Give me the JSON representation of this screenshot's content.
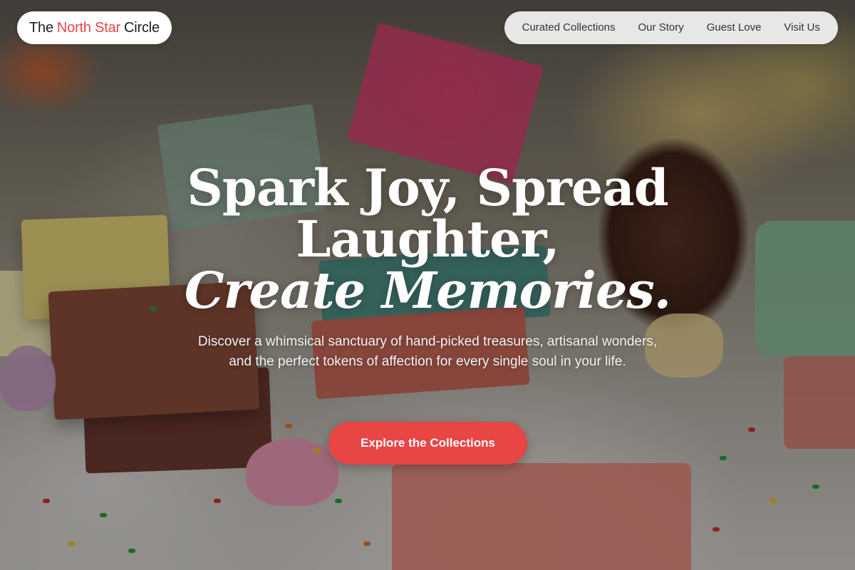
{
  "header": {
    "brand_prefix": "The",
    "brand_accent": "North Star",
    "brand_suffix": "Circle",
    "nav": [
      {
        "label": "Curated Collections"
      },
      {
        "label": "Our Story"
      },
      {
        "label": "Guest Love"
      },
      {
        "label": "Visit Us"
      }
    ]
  },
  "hero": {
    "headline_line1": "Spark Joy, Spread",
    "headline_line2": "Laughter,",
    "headline_line3": "Create Memories.",
    "subtitle": "Discover a whimsical sanctuary of hand-picked treasures, artisanal wonders, and the perfect tokens of affection for every single soul in your life.",
    "cta_label": "Explore the Collections"
  },
  "colors": {
    "accent": "#e84545",
    "logo_bg": "#ffffff",
    "nav_bg": "#f5f5f5"
  }
}
